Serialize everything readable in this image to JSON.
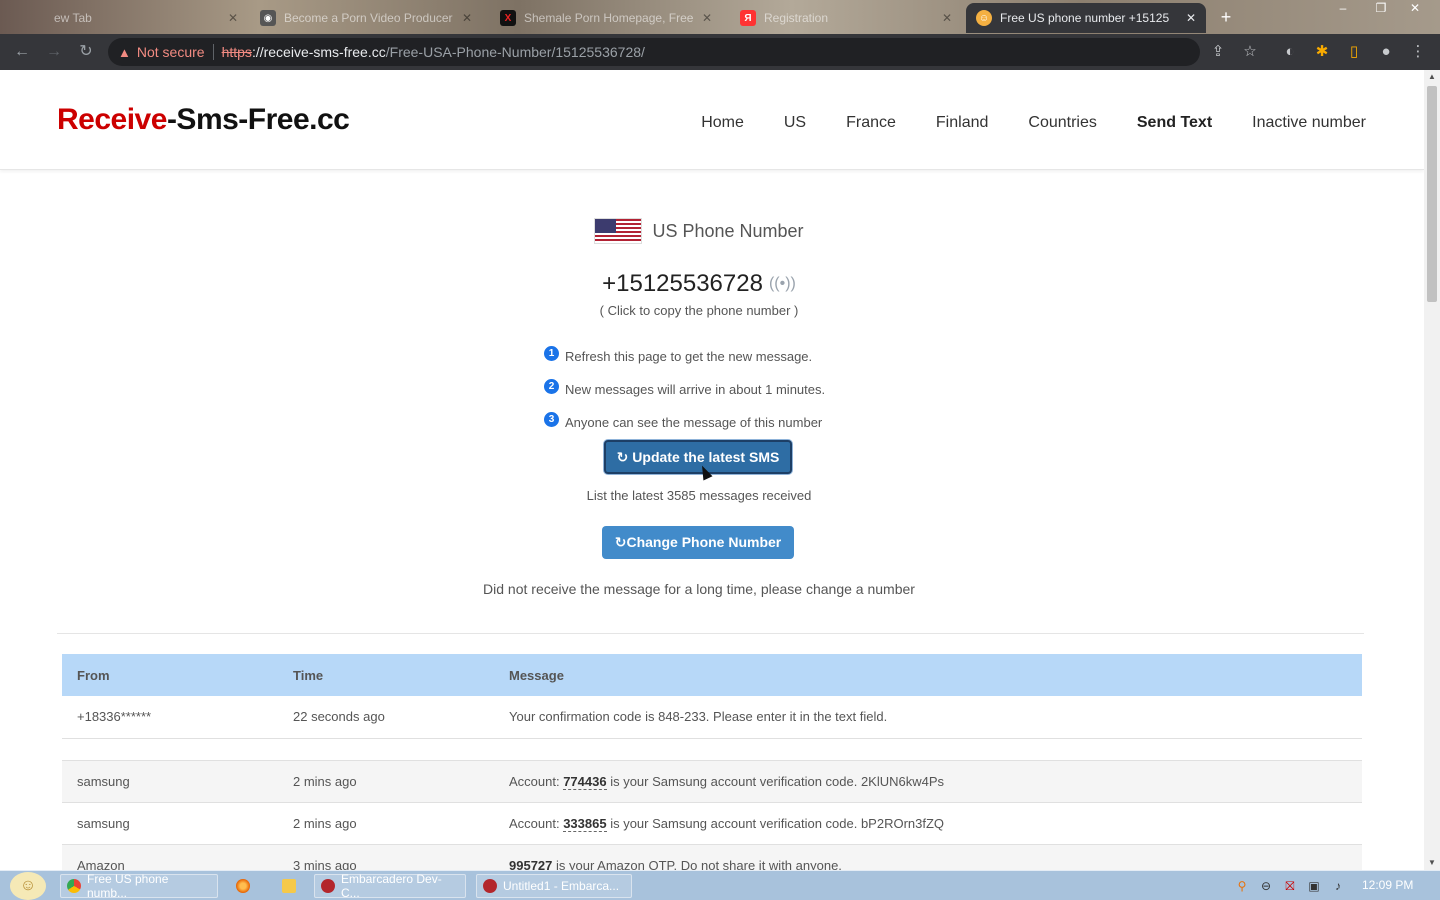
{
  "browser": {
    "tabs": [
      {
        "title": "ew Tab",
        "favicon": "blank-icon"
      },
      {
        "title": "Become a Porn Video Producer",
        "favicon": "site-icon"
      },
      {
        "title": "Shemale Porn Homepage, Free",
        "favicon": "x-icon"
      },
      {
        "title": "Registration",
        "favicon": "yandex-icon"
      },
      {
        "title": "Free US phone number +15125",
        "favicon": "sms-site-icon",
        "active": true
      }
    ],
    "security_label": "Not secure",
    "url_scheme": "https",
    "url_host": "://receive-sms-free.cc",
    "url_path": "/Free-USA-Phone-Number/15125536728/"
  },
  "header": {
    "logo_part1": "Receive",
    "logo_part2": "-Sms-Free.cc",
    "nav": [
      "Home",
      "US",
      "France",
      "Finland",
      "Countries",
      "Send Text",
      "Inactive number"
    ]
  },
  "main": {
    "country_label": "US Phone Number",
    "phone_number": "+15125536728",
    "copy_hint": "( Click to copy the phone number )",
    "steps": [
      {
        "num": "1",
        "text": "Refresh this page to get the new message."
      },
      {
        "num": "2",
        "text": "New messages will arrive in about 1 minutes."
      },
      {
        "num": "3",
        "text": "Anyone can see the message of this number"
      }
    ],
    "update_button": "↻ Update the latest SMS",
    "latest_count_text": "List the latest 3585 messages received",
    "change_button": "↻Change Phone Number",
    "not_received_text": "Did not receive the message for a long time, please change a number"
  },
  "table": {
    "headers": [
      "From",
      "Time",
      "Message"
    ],
    "rows": [
      {
        "from": "+18336******",
        "time": "22 seconds ago",
        "pre": "Your confirmation code is 848-233. Please enter it in the text field.",
        "code": "",
        "post": ""
      },
      {
        "from": "samsung",
        "time": "2 mins ago",
        "pre": "Account: ",
        "code": "774436",
        "post": " is your Samsung account verification code. 2KlUN6kw4Ps"
      },
      {
        "from": "samsung",
        "time": "2 mins ago",
        "pre": "Account: ",
        "code": "333865",
        "post": " is your Samsung account verification code. bP2ROrn3fZQ"
      },
      {
        "from": "Amazon",
        "time": "3 mins ago",
        "pre": "",
        "code": "995727",
        "post": " is your Amazon OTP. Do not share it with anyone."
      }
    ]
  },
  "taskbar": {
    "items": [
      {
        "label": "Free US phone numb..."
      },
      {
        "label": ""
      },
      {
        "label": ""
      },
      {
        "label": "Embarcadero Dev-C..."
      },
      {
        "label": "Untitled1 - Embarca..."
      }
    ],
    "clock": "12:09 PM"
  },
  "colors": {
    "logo_red": "#cc0000",
    "table_header": "#b7d8f8",
    "update_button": "#2e6da4",
    "change_button": "#428bca"
  }
}
